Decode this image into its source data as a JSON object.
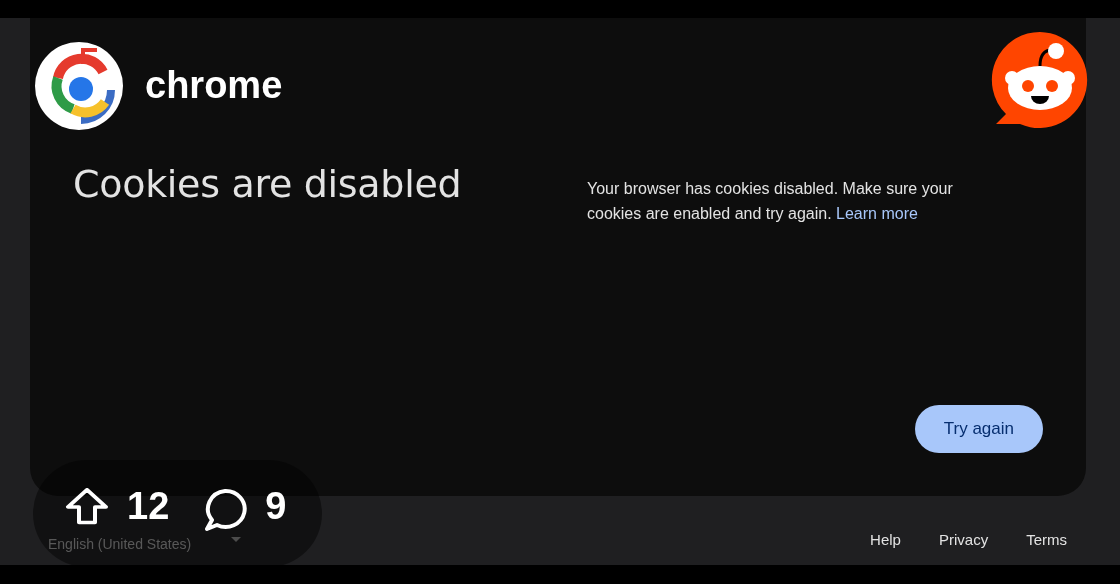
{
  "post": {
    "community": "chrome",
    "upvotes": "12",
    "comments": "9"
  },
  "page": {
    "heading": "Cookies are disabled",
    "message": "Your browser has cookies disabled. Make sure your cookies are enabled and try again.",
    "link": "Learn more",
    "button": "Try again"
  },
  "footer": {
    "language": "English (United States)",
    "links": [
      "Help",
      "Privacy",
      "Terms"
    ]
  }
}
